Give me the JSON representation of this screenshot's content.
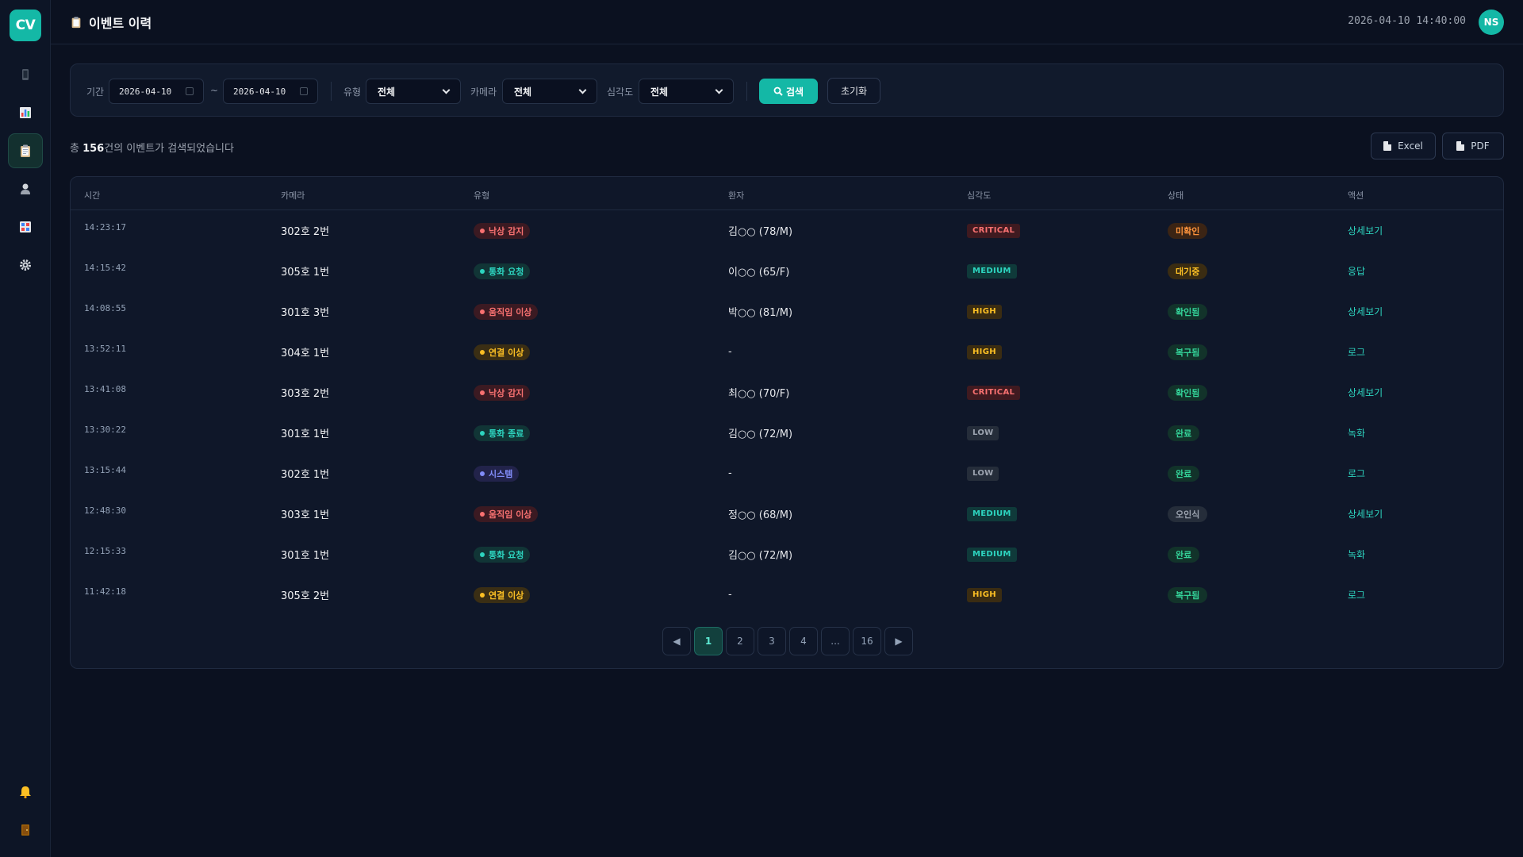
{
  "app": {
    "logo_text": "CV"
  },
  "sidebar": {
    "items": [
      {
        "name": "monitor",
        "icon": "phone-icon",
        "active": false
      },
      {
        "name": "stats",
        "icon": "bar-chart-icon",
        "active": false
      },
      {
        "name": "events",
        "icon": "clipboard-icon",
        "active": true
      },
      {
        "name": "patients",
        "icon": "person-icon",
        "active": false
      },
      {
        "name": "cameras",
        "icon": "device-grid-icon",
        "active": false
      },
      {
        "name": "settings",
        "icon": "gear-icon",
        "active": false
      }
    ],
    "bottom": [
      {
        "name": "notifications",
        "icon": "bell-icon"
      },
      {
        "name": "logout",
        "icon": "door-icon"
      }
    ]
  },
  "header": {
    "title": "이벤트 이력",
    "title_icon": "clipboard-icon",
    "datetime": "2026-04-10 14:40:00",
    "avatar": "NS"
  },
  "filters": {
    "period_label": "기간",
    "date_from": "2026-04-10",
    "date_sep": "~",
    "date_to": "2026-04-10",
    "type_label": "유형",
    "type_value": "전체",
    "camera_label": "카메라",
    "camera_value": "전체",
    "severity_label": "심각도",
    "severity_value": "전체",
    "search_label": "검색",
    "reset_label": "초기화"
  },
  "summary": {
    "prefix": "총 ",
    "count": "156",
    "suffix": "건의 이벤트가 검색되었습니다"
  },
  "export": {
    "excel": "Excel",
    "pdf": "PDF"
  },
  "table": {
    "columns": [
      "시간",
      "카메라",
      "유형",
      "환자",
      "심각도",
      "상태",
      "액션"
    ],
    "rows": [
      {
        "time": "14:23:17",
        "camera": "302호 2번",
        "type": "낙상 감지",
        "type_color": "#f87171",
        "type_bg": "#3b1a22",
        "patient": "김○○ (78/M)",
        "severity": "CRITICAL",
        "status": "미확인",
        "action": "상세보기"
      },
      {
        "time": "14:15:42",
        "camera": "305호 1번",
        "type": "통화 요청",
        "type_color": "#2dd4bf",
        "type_bg": "#113536",
        "patient": "이○○ (65/F)",
        "severity": "MEDIUM",
        "status": "대기중",
        "action": "응답"
      },
      {
        "time": "14:08:55",
        "camera": "301호 3번",
        "type": "움직임 이상",
        "type_color": "#f87171",
        "type_bg": "#3b1a22",
        "patient": "박○○ (81/M)",
        "severity": "HIGH",
        "status": "확인됨",
        "action": "상세보기"
      },
      {
        "time": "13:52:11",
        "camera": "304호 1번",
        "type": "연결 이상",
        "type_color": "#fbbf24",
        "type_bg": "#3a2e14",
        "patient": "-",
        "severity": "HIGH",
        "status": "복구됨",
        "action": "로그"
      },
      {
        "time": "13:41:08",
        "camera": "303호 2번",
        "type": "낙상 감지",
        "type_color": "#f87171",
        "type_bg": "#3b1a22",
        "patient": "최○○ (70/F)",
        "severity": "CRITICAL",
        "status": "확인됨",
        "action": "상세보기"
      },
      {
        "time": "13:30:22",
        "camera": "301호 1번",
        "type": "통화 종료",
        "type_color": "#2dd4bf",
        "type_bg": "#113536",
        "patient": "김○○ (72/M)",
        "severity": "LOW",
        "status": "완료",
        "action": "녹화"
      },
      {
        "time": "13:15:44",
        "camera": "302호 1번",
        "type": "시스템",
        "type_color": "#818cf8",
        "type_bg": "#22234a",
        "patient": "-",
        "severity": "LOW",
        "status": "완료",
        "action": "로그"
      },
      {
        "time": "12:48:30",
        "camera": "303호 1번",
        "type": "움직임 이상",
        "type_color": "#f87171",
        "type_bg": "#3b1a22",
        "patient": "정○○ (68/M)",
        "severity": "MEDIUM",
        "status": "오인식",
        "action": "상세보기"
      },
      {
        "time": "12:15:33",
        "camera": "301호 1번",
        "type": "통화 요청",
        "type_color": "#2dd4bf",
        "type_bg": "#113536",
        "patient": "김○○ (72/M)",
        "severity": "MEDIUM",
        "status": "완료",
        "action": "녹화"
      },
      {
        "time": "11:42:18",
        "camera": "305호 2번",
        "type": "연결 이상",
        "type_color": "#fbbf24",
        "type_bg": "#3a2e14",
        "patient": "-",
        "severity": "HIGH",
        "status": "복구됨",
        "action": "로그"
      }
    ]
  },
  "severity_styles": {
    "CRITICAL": {
      "color": "#f87171",
      "bg": "#3f1a20"
    },
    "HIGH": {
      "color": "#fbbf24",
      "bg": "#3a2c12"
    },
    "MEDIUM": {
      "color": "#2dd4bf",
      "bg": "#0f3a3a"
    },
    "LOW": {
      "color": "#9ca3af",
      "bg": "#252d3a"
    }
  },
  "status_styles": {
    "미확인": {
      "color": "#fb923c",
      "bg": "#3b2414"
    },
    "대기중": {
      "color": "#fbbf24",
      "bg": "#3a2c12"
    },
    "확인됨": {
      "color": "#34d399",
      "bg": "#12332a"
    },
    "복구됨": {
      "color": "#34d399",
      "bg": "#12332a"
    },
    "완료": {
      "color": "#34d399",
      "bg": "#12332a"
    },
    "오인식": {
      "color": "#9ca3af",
      "bg": "#252d3a"
    }
  },
  "pagination": {
    "prev": "◀",
    "pages": [
      "1",
      "2",
      "3",
      "4",
      "...",
      "16"
    ],
    "current": "1",
    "next": "▶"
  }
}
